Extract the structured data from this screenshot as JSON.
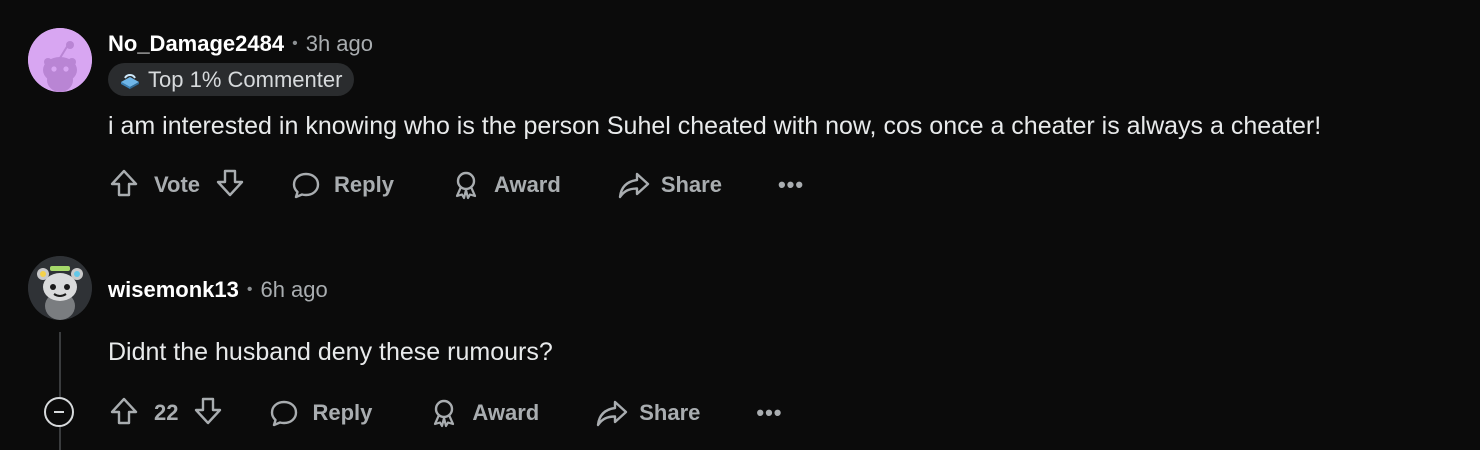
{
  "comments": [
    {
      "username": "No_Damage2484",
      "separator": "•",
      "time": "3h ago",
      "flair": "Top 1% Commenter",
      "body": "i am interested in knowing who is the person Suhel cheated with now, cos once a cheater is always a cheater!",
      "actions": {
        "vote_label": "Vote",
        "reply_label": "Reply",
        "award_label": "Award",
        "share_label": "Share",
        "more_label": "•••"
      }
    },
    {
      "username": "wisemonk13",
      "separator": "•",
      "time": "6h ago",
      "body": "Didnt the husband deny these rumours?",
      "actions": {
        "vote_label": "22",
        "reply_label": "Reply",
        "award_label": "Award",
        "share_label": "Share",
        "more_label": "•••"
      }
    }
  ],
  "icons": {
    "upvote": "upvote-icon",
    "downvote": "downvote-icon",
    "reply": "reply-bubble-icon",
    "award": "award-icon",
    "share": "share-arrow-icon",
    "collapse": "collapse-minus-icon"
  },
  "colors": {
    "background": "#0b0b0b",
    "text": "#d7dadc",
    "muted": "#a9adb0",
    "avatar1": "#d8a6f2"
  }
}
